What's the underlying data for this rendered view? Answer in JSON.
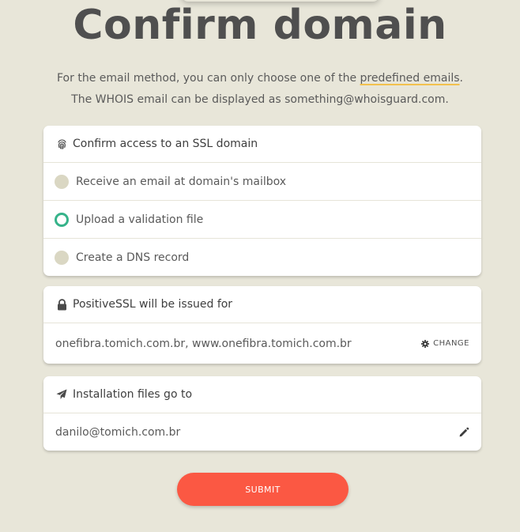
{
  "page": {
    "title": "Confirm domain",
    "subtitle_part1": "For the email method, you can only choose one of the ",
    "subtitle_link": "predefined emails",
    "subtitle_part2": ".",
    "subtitle_line2": "The WHOIS email can be displayed as something@whoisguard.com."
  },
  "method_card": {
    "icon": "fingerprint-icon",
    "header": "Confirm access to an SSL domain",
    "options": [
      {
        "label": "Receive an email at domain's mailbox",
        "selected": false
      },
      {
        "label": "Upload a validation file",
        "selected": true
      },
      {
        "label": "Create a DNS record",
        "selected": false
      }
    ]
  },
  "issued_card": {
    "icon": "lock-icon",
    "header": "PositiveSSL will be issued for",
    "domains": "onefibra.tomich.com.br, www.onefibra.tomich.com.br",
    "change_label": "CHANGE",
    "change_icon": "gear-icon"
  },
  "files_card": {
    "icon": "paper-plane-icon",
    "header": "Installation files go to",
    "email": "danilo@tomich.com.br",
    "edit_icon": "pencil-icon"
  },
  "submit_label": "SUBMIT",
  "colors": {
    "background": "#e8e6d9",
    "accent_green": "#36b38a",
    "submit_red": "#fb5843",
    "underline_yellow": "#f2c14e"
  }
}
